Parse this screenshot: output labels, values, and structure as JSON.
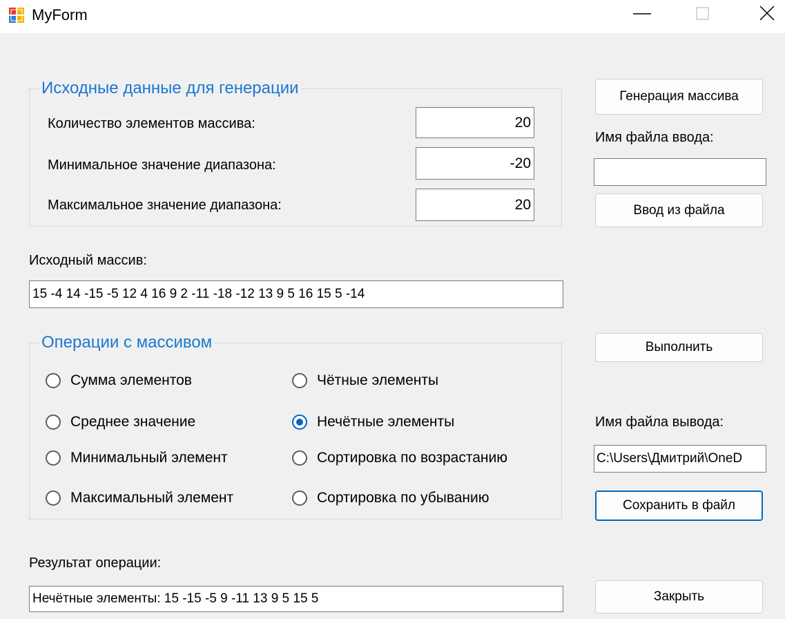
{
  "window": {
    "title": "MyForm",
    "minimize_glyph": "—",
    "close_glyph": "✕"
  },
  "source_group": {
    "title": "Исходные данные для генерации",
    "count_label": "Количество элементов массива:",
    "count_value": "20",
    "min_label": "Минимальное значение диапазона:",
    "min_value": "-20",
    "max_label": "Максимальное значение диапазона:",
    "max_value": "20"
  },
  "side": {
    "generate_button": "Генерация массива",
    "input_file_label": "Имя файла ввода:",
    "input_file_value": "",
    "load_button": "Ввод из файла",
    "execute_button": "Выполнить",
    "output_file_label": "Имя файла вывода:",
    "output_file_value": "C:\\Users\\Дмитрий\\OneD",
    "save_button": "Сохранить в файл",
    "close_button": "Закрыть"
  },
  "array": {
    "label": "Исходный массив:",
    "value": "15 -4 14 -15 -5 12 4 16 9 2 -11 -18 -12 13 9 5 16 15 5 -14"
  },
  "ops_group": {
    "title": "Операции с массивом",
    "options": [
      {
        "label": "Сумма элементов",
        "checked": false
      },
      {
        "label": "Среднее значение",
        "checked": false
      },
      {
        "label": "Минимальный элемент",
        "checked": false
      },
      {
        "label": "Максимальный элемент",
        "checked": false
      },
      {
        "label": "Чётные элементы",
        "checked": false
      },
      {
        "label": "Нечётные элементы",
        "checked": true
      },
      {
        "label": "Сортировка по возрастанию",
        "checked": false
      },
      {
        "label": "Сортировка по убыванию",
        "checked": false
      }
    ]
  },
  "result": {
    "label": "Результат операции:",
    "value": "Нечётные элементы: 15 -15 -5 9 -11 13 9 5 15 5"
  }
}
